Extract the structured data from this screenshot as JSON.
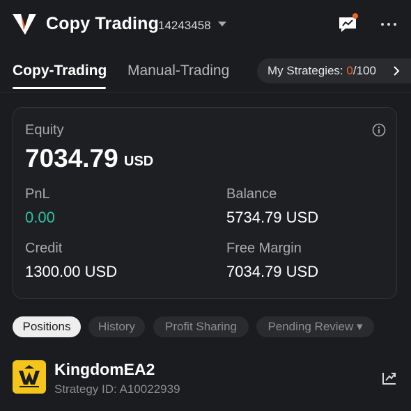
{
  "header": {
    "title": "Copy Trading",
    "account_number": "14243458",
    "icons": {
      "logo": "v-logo",
      "account_caret": "caret-down-icon",
      "chat": "chart-message-icon",
      "more": "more-dots-icon"
    },
    "colors": {
      "background": "#1b1c1f",
      "notification_dot": "#f0642c"
    }
  },
  "tabs": {
    "copy_trading": "Copy-Trading",
    "manual_trading": "Manual-Trading",
    "active": "Copy-Trading"
  },
  "strategies_pill": {
    "label": "My Strategies: ",
    "count": "0",
    "max": "/100",
    "count_color": "#f0642c"
  },
  "account_card": {
    "equity_label": "Equity",
    "equity_value": "7034.79",
    "equity_unit": "USD",
    "pnl_label": "PnL",
    "pnl_value": "0.00",
    "pnl_color": "#2cc3a0",
    "balance_label": "Balance",
    "balance_value": "5734.79 USD",
    "credit_label": "Credit",
    "credit_value": "1300.00 USD",
    "free_margin_label": "Free Margin",
    "free_margin_value": "7034.79 USD"
  },
  "filter_chips": {
    "positions": "Positions",
    "history": "History",
    "profit_sharing": "Profit Sharing",
    "pending_review": "Pending Review ▾",
    "active": "Positions"
  },
  "strategy": {
    "name": "KingdomEA2",
    "id_label": "Strategy ID: A10022939",
    "avatar_color": "#f4c51b",
    "action_icon": "share-icon"
  }
}
